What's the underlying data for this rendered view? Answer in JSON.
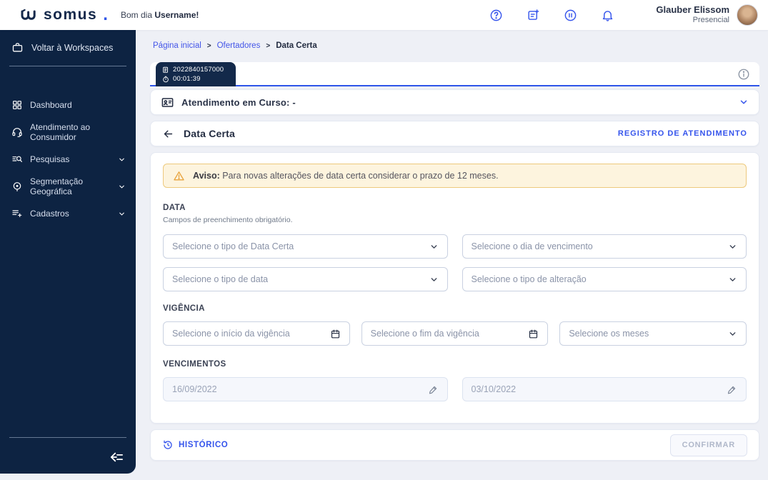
{
  "header": {
    "logo_text": "somus",
    "logo_dot": ".",
    "greeting_prefix": "Bom dia ",
    "greeting_name": "Username!",
    "user": {
      "name": "Glauber Elissom",
      "status": "Presencial"
    }
  },
  "sidebar": {
    "back_label": "Voltar à Workspaces",
    "items": [
      {
        "label": "Dashboard",
        "icon": "dashboard-icon",
        "expandable": false
      },
      {
        "label": "Atendimento ao Consumidor",
        "icon": "headset-icon",
        "expandable": false
      },
      {
        "label": "Pesquisas",
        "icon": "search-list-icon",
        "expandable": true
      },
      {
        "label": "Segmentação Geográfica",
        "icon": "geo-target-icon",
        "expandable": true
      },
      {
        "label": "Cadastros",
        "icon": "list-add-icon",
        "expandable": true
      }
    ]
  },
  "breadcrumb": {
    "separator": ">",
    "items": [
      "Página inicial",
      "Ofertadores",
      "Data Certa"
    ]
  },
  "session_tab": {
    "id": "2022840157000",
    "timer": "00:01:39"
  },
  "attendance_bar": {
    "label": "Atendimento em Curso: -"
  },
  "page_header": {
    "title": "Data Certa",
    "action": "REGISTRO DE ATENDIMENTO"
  },
  "warning": {
    "bold": "Aviso:",
    "text": " Para novas alterações de data certa considerar o prazo de 12 meses."
  },
  "form": {
    "data_section": {
      "title": "DATA",
      "subtitle": "Campos de preenchimento obrigatório.",
      "selects": [
        {
          "placeholder": "Selecione o tipo de Data Certa"
        },
        {
          "placeholder": "Selecione o dia de vencimento"
        },
        {
          "placeholder": "Selecione o tipo de data"
        },
        {
          "placeholder": "Selecione o tipo de alteração"
        }
      ]
    },
    "vigencia_section": {
      "title": "VIGÊNCIA",
      "start_placeholder": "Selecione o início da vigência",
      "end_placeholder": "Selecione o fim da vigência",
      "months_placeholder": "Selecione os meses"
    },
    "vencimentos_section": {
      "title": "VENCIMENTOS",
      "values": [
        "16/09/2022",
        "03/10/2022"
      ]
    }
  },
  "footer": {
    "history_label": "HISTÓRICO",
    "confirm_label": "CONFIRMAR"
  },
  "colors": {
    "accent_blue": "#3554ec",
    "sidebar_navy": "#0d2342",
    "tab_navy": "#13294a",
    "warning_bg": "#fdf4de",
    "warning_border": "#edc97d",
    "warning_icon": "#e8a33d",
    "page_bg": "#eef0f6"
  }
}
